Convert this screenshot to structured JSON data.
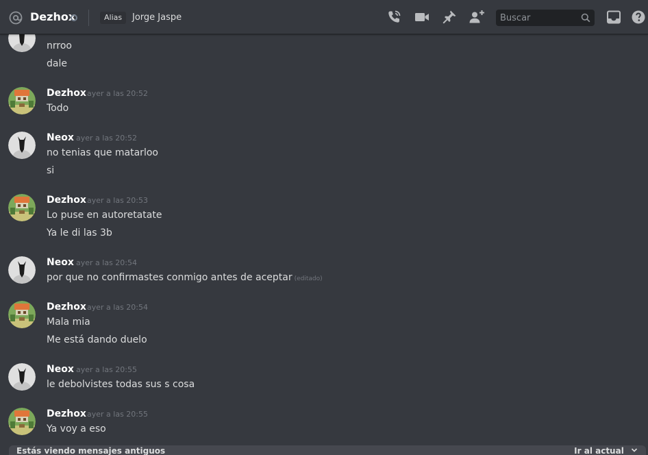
{
  "header": {
    "dm_name": "Dezhox",
    "alias_label": "Alias",
    "alias_value": "Jorge Jaspe",
    "search_placeholder": "Buscar"
  },
  "messages": [
    {
      "author": "",
      "timestamp": "",
      "lines": [
        "nrroo",
        "dale"
      ],
      "avatar": "neox"
    },
    {
      "author": "Dezhox",
      "timestamp": "ayer a las 20:52",
      "lines": [
        "Todo"
      ],
      "avatar": "dezhox"
    },
    {
      "author": "Neox",
      "timestamp": "ayer a las 20:52",
      "lines": [
        "no tenias que matarloo",
        "si"
      ],
      "avatar": "neox"
    },
    {
      "author": "Dezhox",
      "timestamp": "ayer a las 20:53",
      "lines": [
        "Lo puse en autoretatate",
        "Ya le di las 3b"
      ],
      "avatar": "dezhox"
    },
    {
      "author": "Neox",
      "timestamp": "ayer a las 20:54",
      "lines": [
        "por que no confirmastes conmigo antes de aceptar"
      ],
      "edited": "(editado)",
      "avatar": "neox"
    },
    {
      "author": "Dezhox",
      "timestamp": "ayer a las 20:54",
      "lines": [
        "Mala mia",
        "Me está dando duelo"
      ],
      "avatar": "dezhox"
    },
    {
      "author": "Neox",
      "timestamp": "ayer a las 20:55",
      "lines": [
        "le debolvistes todas sus s cosa"
      ],
      "avatar": "neox"
    },
    {
      "author": "Dezhox",
      "timestamp": "ayer a las 20:55",
      "lines": [
        "Ya voy a eso"
      ],
      "avatar": "dezhox"
    }
  ],
  "bottom_bar": {
    "old_messages_text": "Estás viendo mensajes antiguos",
    "jump_label": "Ir al actual"
  },
  "colors": {
    "background": "#36393f",
    "username": "#ffffff",
    "timestamp": "#72767d",
    "text": "#dcddde"
  }
}
